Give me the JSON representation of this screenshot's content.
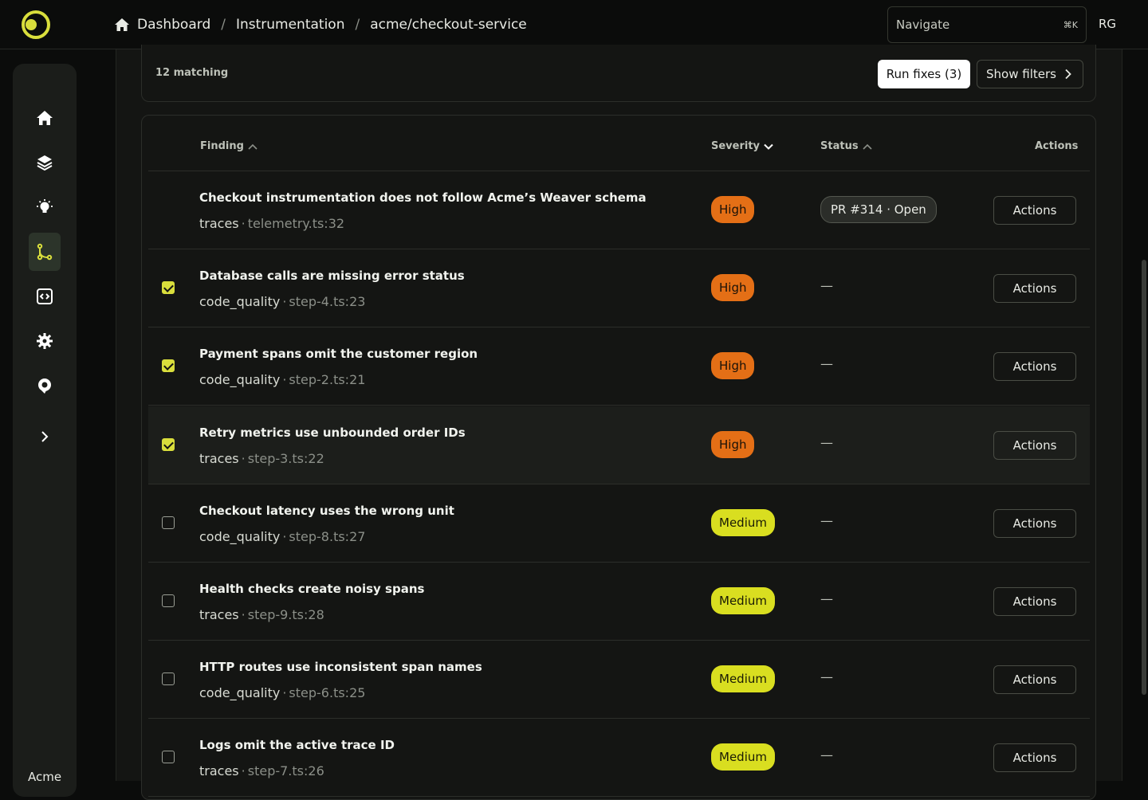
{
  "header": {
    "breadcrumb": [
      "Dashboard",
      "Instrumentation",
      "acme/checkout-service"
    ],
    "navigate_label": "Navigate",
    "navigate_shortcut": "⌘K",
    "user_initials": "RG"
  },
  "sidebar": {
    "items": [
      {
        "icon": "home-icon"
      },
      {
        "icon": "layers-icon"
      },
      {
        "icon": "lightbulb-icon"
      },
      {
        "icon": "git-branch-icon",
        "active": true
      },
      {
        "icon": "code-icon"
      },
      {
        "icon": "gear-icon"
      },
      {
        "icon": "support-icon"
      }
    ],
    "expand_icon": "chevron-right-icon",
    "org_label": "Acme"
  },
  "filters": {
    "matching": "12 matching",
    "run_fixes": "Run fixes (3)",
    "show_filters": "Show filters"
  },
  "table": {
    "columns": {
      "finding": "Finding",
      "severity": "Severity",
      "status": "Status",
      "actions": "Actions"
    },
    "rows": [
      {
        "checkbox": "none",
        "title": "Checkout instrumentation does not follow Acme’s Weaver schema",
        "category": "traces",
        "location": "telemetry.ts:32",
        "severity": "High",
        "status": "PR #314 · Open",
        "action": "Actions"
      },
      {
        "checkbox": "checked",
        "title": "Database calls are missing error status",
        "category": "code_quality",
        "location": "step-4.ts:23",
        "severity": "High",
        "status": "—",
        "action": "Actions"
      },
      {
        "checkbox": "checked",
        "title": "Payment spans omit the customer region",
        "category": "code_quality",
        "location": "step-2.ts:21",
        "severity": "High",
        "status": "—",
        "action": "Actions"
      },
      {
        "checkbox": "checked",
        "title": "Retry metrics use unbounded order IDs",
        "category": "traces",
        "location": "step-3.ts:22",
        "severity": "High",
        "status": "—",
        "action": "Actions"
      },
      {
        "checkbox": "unchecked",
        "title": "Checkout latency uses the wrong unit",
        "category": "code_quality",
        "location": "step-8.ts:27",
        "severity": "Medium",
        "status": "—",
        "action": "Actions"
      },
      {
        "checkbox": "unchecked",
        "title": "Health checks create noisy spans",
        "category": "traces",
        "location": "step-9.ts:28",
        "severity": "Medium",
        "status": "—",
        "action": "Actions"
      },
      {
        "checkbox": "unchecked",
        "title": "HTTP routes use inconsistent span names",
        "category": "code_quality",
        "location": "step-6.ts:25",
        "severity": "Medium",
        "status": "—",
        "action": "Actions"
      },
      {
        "checkbox": "unchecked",
        "title": "Logs omit the active trace ID",
        "category": "traces",
        "location": "step-7.ts:26",
        "severity": "Medium",
        "status": "—",
        "action": "Actions"
      }
    ]
  },
  "colors": {
    "accent": "#d9de3c",
    "high": "#e46f16",
    "medium": "#d9de20"
  }
}
